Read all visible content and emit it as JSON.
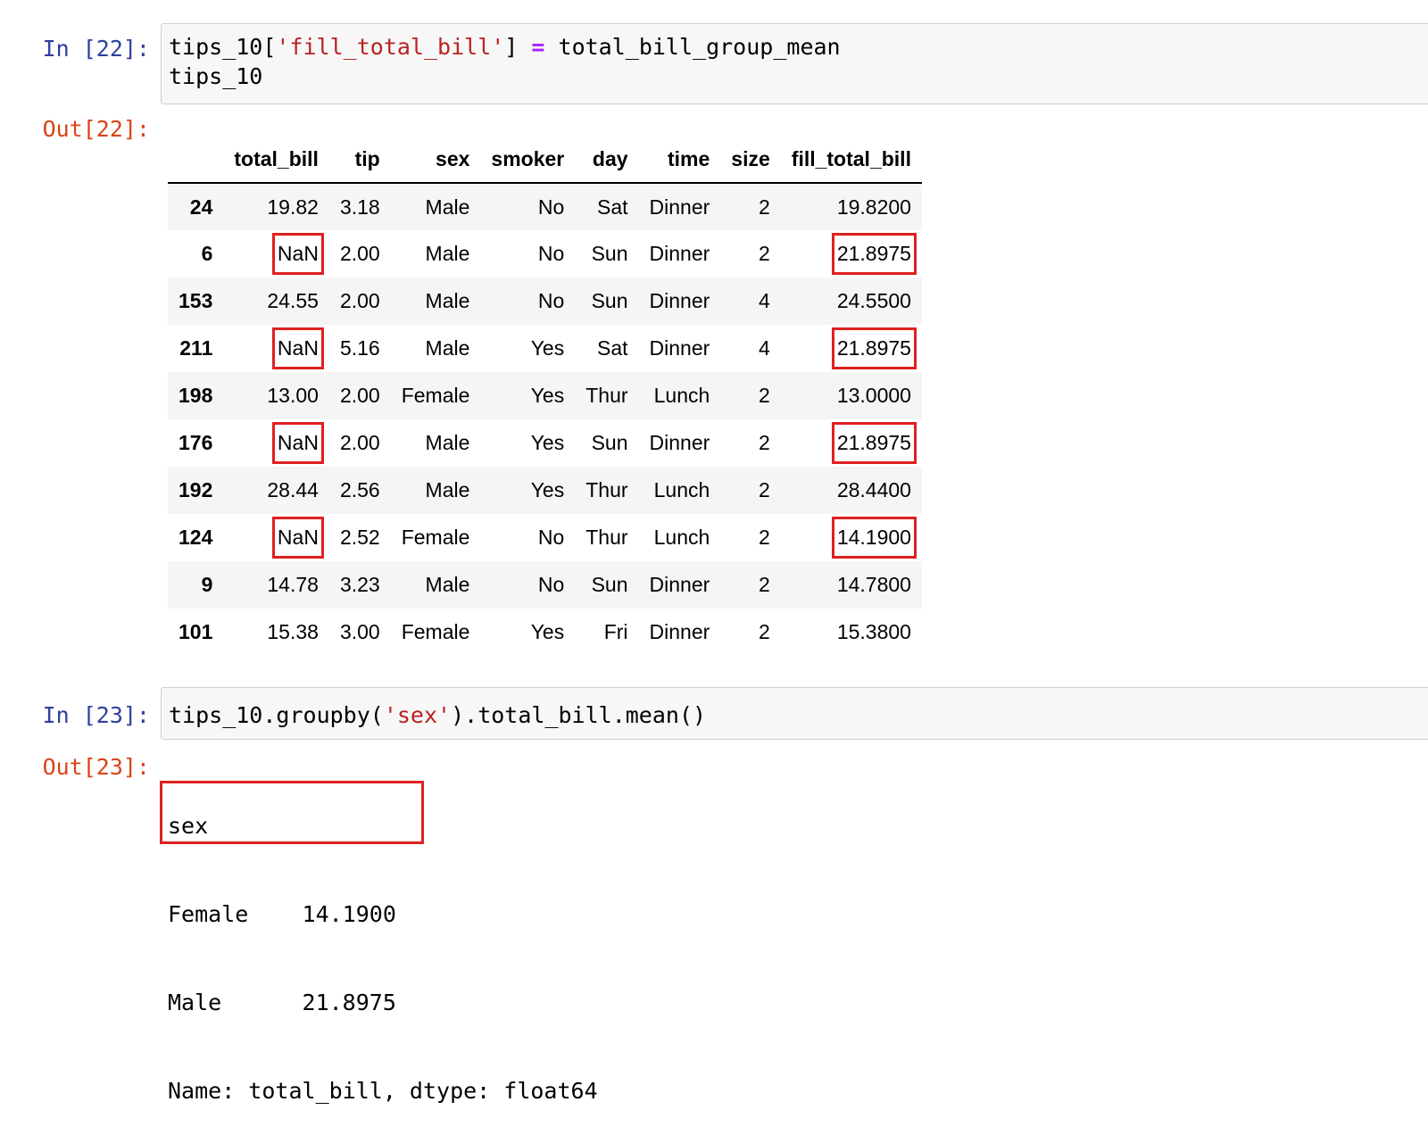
{
  "cells": [
    {
      "in_prompt": "In [22]:",
      "code_tokens": [
        {
          "t": "tips_10[",
          "k": "plain"
        },
        {
          "t": "'fill_total_bill'",
          "k": "str"
        },
        {
          "t": "] ",
          "k": "plain"
        },
        {
          "t": "=",
          "k": "op"
        },
        {
          "t": " total_bill_group_mean\ntips_10",
          "k": "plain"
        }
      ],
      "out_prompt": "Out[22]:"
    },
    {
      "in_prompt": "In [23]:",
      "code_tokens": [
        {
          "t": "tips_10.groupby(",
          "k": "plain"
        },
        {
          "t": "'sex'",
          "k": "str"
        },
        {
          "t": ").total_bill.mean()",
          "k": "plain"
        }
      ],
      "out_prompt": "Out[23]:"
    }
  ],
  "dataframe": {
    "columns": [
      "",
      "total_bill",
      "tip",
      "sex",
      "smoker",
      "day",
      "time",
      "size",
      "fill_total_bill"
    ],
    "rows": [
      {
        "index": "24",
        "cells": [
          "19.82",
          "3.18",
          "Male",
          "No",
          "Sat",
          "Dinner",
          "2",
          "19.8200"
        ],
        "highlight": []
      },
      {
        "index": "6",
        "cells": [
          "NaN",
          "2.00",
          "Male",
          "No",
          "Sun",
          "Dinner",
          "2",
          "21.8975"
        ],
        "highlight": [
          0,
          7
        ]
      },
      {
        "index": "153",
        "cells": [
          "24.55",
          "2.00",
          "Male",
          "No",
          "Sun",
          "Dinner",
          "4",
          "24.5500"
        ],
        "highlight": []
      },
      {
        "index": "211",
        "cells": [
          "NaN",
          "5.16",
          "Male",
          "Yes",
          "Sat",
          "Dinner",
          "4",
          "21.8975"
        ],
        "highlight": [
          0,
          7
        ]
      },
      {
        "index": "198",
        "cells": [
          "13.00",
          "2.00",
          "Female",
          "Yes",
          "Thur",
          "Lunch",
          "2",
          "13.0000"
        ],
        "highlight": []
      },
      {
        "index": "176",
        "cells": [
          "NaN",
          "2.00",
          "Male",
          "Yes",
          "Sun",
          "Dinner",
          "2",
          "21.8975"
        ],
        "highlight": [
          0,
          7
        ]
      },
      {
        "index": "192",
        "cells": [
          "28.44",
          "2.56",
          "Male",
          "Yes",
          "Thur",
          "Lunch",
          "2",
          "28.4400"
        ],
        "highlight": []
      },
      {
        "index": "124",
        "cells": [
          "NaN",
          "2.52",
          "Female",
          "No",
          "Thur",
          "Lunch",
          "2",
          "14.1900"
        ],
        "highlight": [
          0,
          7
        ]
      },
      {
        "index": "9",
        "cells": [
          "14.78",
          "3.23",
          "Male",
          "No",
          "Sun",
          "Dinner",
          "2",
          "14.7800"
        ],
        "highlight": []
      },
      {
        "index": "101",
        "cells": [
          "15.38",
          "3.00",
          "Female",
          "Yes",
          "Fri",
          "Dinner",
          "2",
          "15.3800"
        ],
        "highlight": []
      }
    ],
    "highlight_color": "#e02020"
  },
  "series_output": {
    "header": "sex",
    "lines": [
      "Female    14.1900",
      "Male      21.8975"
    ],
    "footer": "Name: total_bill, dtype: float64"
  },
  "colors": {
    "in_prompt": "#303f9f",
    "out_prompt": "#d84315",
    "string": "#ba2121",
    "operator": "#aa22ff"
  }
}
